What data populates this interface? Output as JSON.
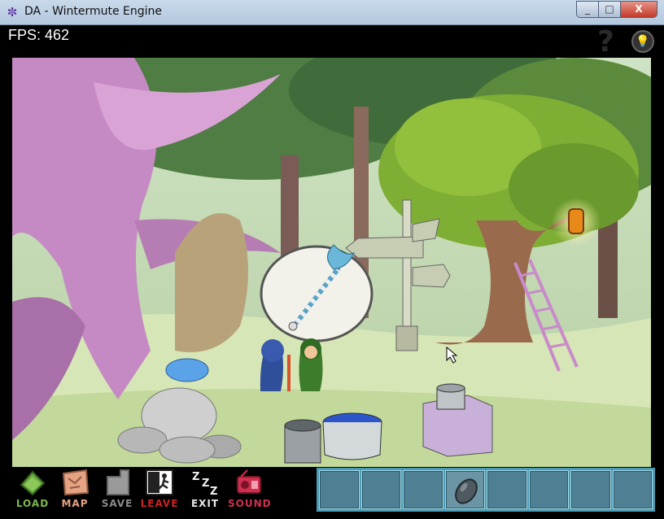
{
  "window": {
    "title": "DA - Wintermute Engine",
    "min": "_",
    "max": "□",
    "close": "X"
  },
  "hud": {
    "fps": "FPS: 462"
  },
  "toolbar": {
    "items": [
      {
        "label": "LOAD",
        "color": "#5a8f3a"
      },
      {
        "label": "MAP",
        "color": "#c9866a"
      },
      {
        "label": "SAVE",
        "color": "#8a8a8a"
      },
      {
        "label": "LEAVE",
        "color": "#cc2222"
      },
      {
        "label": "EXIT",
        "color": "#e8e8e8"
      },
      {
        "label": "SOUND",
        "color": "#d03050"
      }
    ]
  },
  "inventory": {
    "slots": 8,
    "item": "stone-icon",
    "item_slot": 4
  },
  "scene": {
    "signpost": "signpost",
    "thought": "magic-staff"
  }
}
